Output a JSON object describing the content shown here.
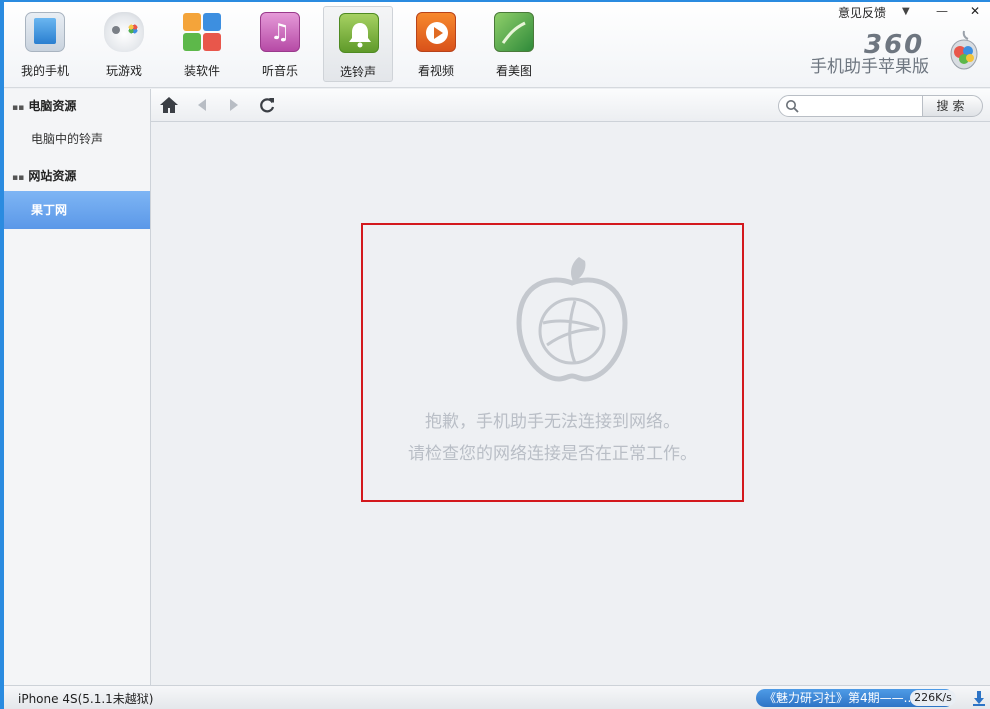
{
  "nav": {
    "items": [
      {
        "label": "我的手机",
        "icon": "phone-icon"
      },
      {
        "label": "玩游戏",
        "icon": "gamepad-icon"
      },
      {
        "label": "装软件",
        "icon": "apps-icon"
      },
      {
        "label": "听音乐",
        "icon": "music-note-icon"
      },
      {
        "label": "选铃声",
        "icon": "bell-icon"
      },
      {
        "label": "看视频",
        "icon": "play-icon"
      },
      {
        "label": "看美图",
        "icon": "photo-icon"
      }
    ],
    "active_label": "选铃声"
  },
  "window": {
    "feedback": "意见反馈",
    "menu_glyph": "▼",
    "minimize_glyph": "—",
    "close_glyph": "✕"
  },
  "brand": {
    "logo_number": "360",
    "logo_subtitle": "手机助手苹果版"
  },
  "sidebar": {
    "section1_title": "电脑资源",
    "section1_items": [
      "电脑中的铃声"
    ],
    "section2_title": "网站资源",
    "section2_items": [
      "果丁网"
    ],
    "active_item": "果丁网"
  },
  "toolbar": {
    "search_placeholder": "",
    "search_button": "搜索"
  },
  "error": {
    "line1": "抱歉，手机助手无法连接到网络。",
    "line2": "请检查您的网络连接是否在正常工作。"
  },
  "statusbar": {
    "device": "iPhone 4S(5.1.1未越狱)",
    "news": "《魅力研习社》第4期——...",
    "speed": "226K/s"
  },
  "colors": {
    "accent_blue": "#2a8be0",
    "sidebar_active": "#5b98e8",
    "error_border": "#d3181c"
  }
}
